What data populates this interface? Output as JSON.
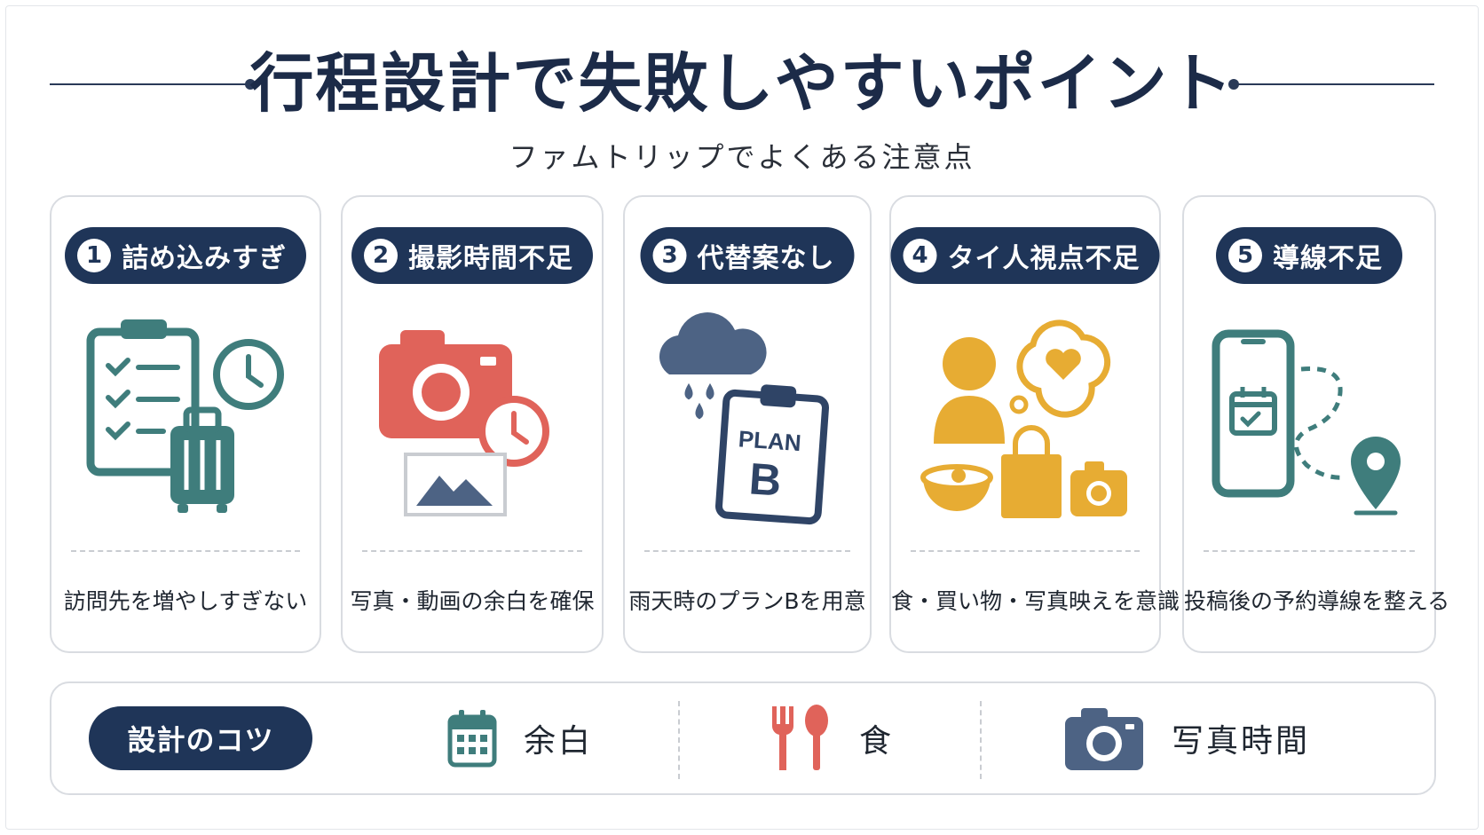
{
  "header": {
    "title": "行程設計で失敗しやすいポイント",
    "subtitle": "ファムトリップでよくある注意点"
  },
  "cards": [
    {
      "num": "1",
      "label": "詰め込みすぎ",
      "caption": "訪問先を増やしすぎない",
      "icon": "checklist-luggage-clock-icon"
    },
    {
      "num": "2",
      "label": "撮影時間不足",
      "caption": "写真・動画の余白を確保",
      "icon": "camera-clock-photo-icon"
    },
    {
      "num": "3",
      "label": "代替案なし",
      "caption": "雨天時のプランBを用意",
      "icon": "rain-cloud-planb-icon",
      "plan_text": "PLAN",
      "plan_letter": "B"
    },
    {
      "num": "4",
      "label": "タイ人視点不足",
      "caption": "食・買い物・写真映えを意識",
      "icon": "person-food-shopping-camera-icon"
    },
    {
      "num": "5",
      "label": "導線不足",
      "caption": "投稿後の予約導線を整える",
      "icon": "phone-route-pin-icon"
    }
  ],
  "tips": {
    "label": "設計のコツ",
    "items": [
      {
        "label": "余白",
        "icon": "calendar-icon"
      },
      {
        "label": "食",
        "icon": "fork-spoon-icon"
      },
      {
        "label": "写真時間",
        "icon": "camera-icon"
      }
    ]
  },
  "colors": {
    "navy": "#1f3558",
    "teal": "#3f7d7c",
    "coral": "#e0635a",
    "slate": "#4d6384",
    "mustard": "#e7ac33"
  }
}
